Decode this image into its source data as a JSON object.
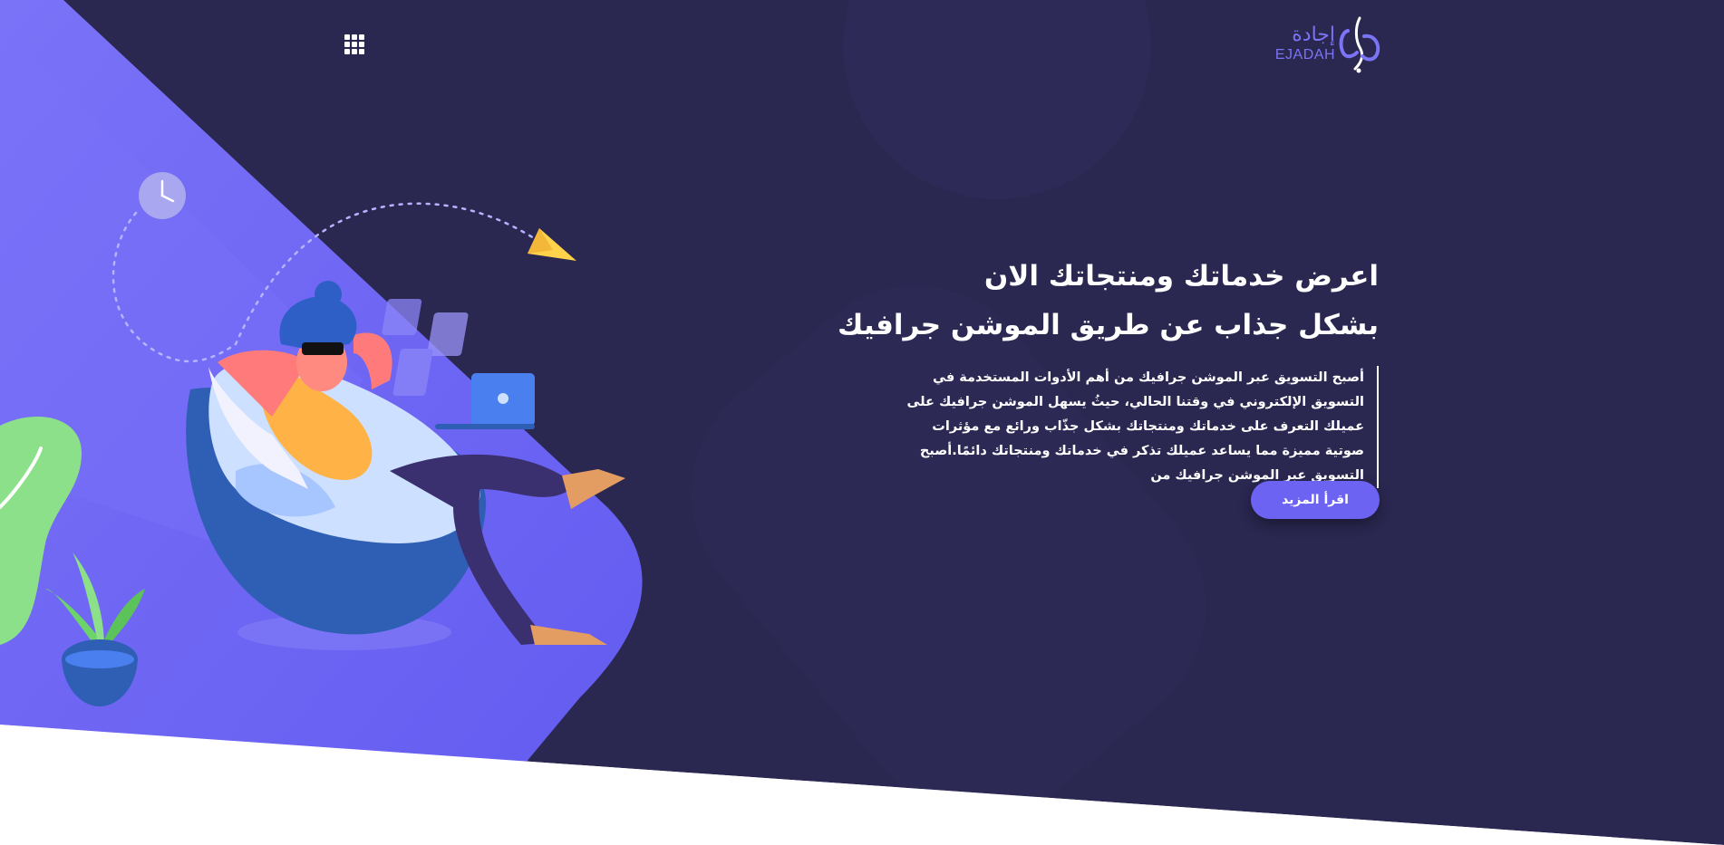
{
  "header": {
    "menu_icon": "grid-menu-icon",
    "logo": {
      "arabic": "إجادة",
      "latin": "EJADAH"
    }
  },
  "hero": {
    "title_line_1": "اعرض خدماتك ومنتجاتك الان",
    "title_line_2": "بشكل جذاب عن طريق الموشن جرافيك",
    "description": "أصبح التسويق عبر الموشن جرافيك من أهم الأدوات المستخدمة في التسويق الإلكتروني في وقتنا الحالي، حيثُ يسهل الموشن جرافيك على عميلك التعرف على خدماتك ومنتجاتك بشكل جذّاب ورائع مع مؤثرات صوتية مميزة مما يساعد عميلك تذكر في خدماتك ومنتجاتك دائمًا.أصبح التسويق عبر الموشن جرافيك من",
    "read_more_label": "اقرأ المزيد"
  },
  "colors": {
    "navy": "#2a2750",
    "purple": "#6c63f2",
    "white": "#ffffff"
  }
}
